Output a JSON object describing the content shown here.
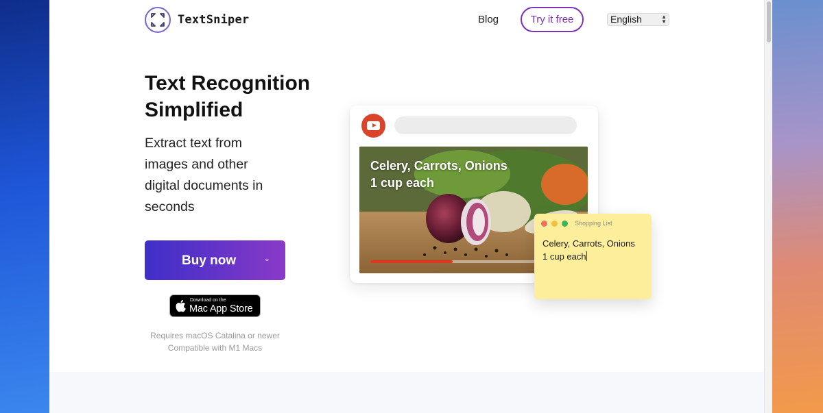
{
  "brand": {
    "name": "TextSniper"
  },
  "nav": {
    "blog": "Blog",
    "try_free": "Try it free",
    "language": "English"
  },
  "hero": {
    "title": "Text Recognition Simplified",
    "subtitle": "Extract text from images and other digital documents in seconds",
    "buy_button": "Buy now",
    "appstore_small": "Download on the",
    "appstore_big": "Mac App Store",
    "requirements": [
      "Requires macOS Catalina or newer",
      "Compatible with M1 Macs"
    ]
  },
  "illustration": {
    "video_caption": "Celery, Carrots, Onions\n1 cup each",
    "video_progress": 0.4,
    "note_title": "Shopping List",
    "note_text": "Celery, Carrots, Onions\n1 cup each"
  },
  "colors": {
    "accent": "#7a33b8",
    "button_gradient_start": "#3f2fc8",
    "button_gradient_end": "#8a3ac8",
    "youtube_red": "#d9452a",
    "note_yellow": "#fdee9c"
  },
  "icons": [
    "textsniper-logo-icon",
    "chevron-down-icon",
    "apple-icon",
    "youtube-icon",
    "window-controls"
  ]
}
